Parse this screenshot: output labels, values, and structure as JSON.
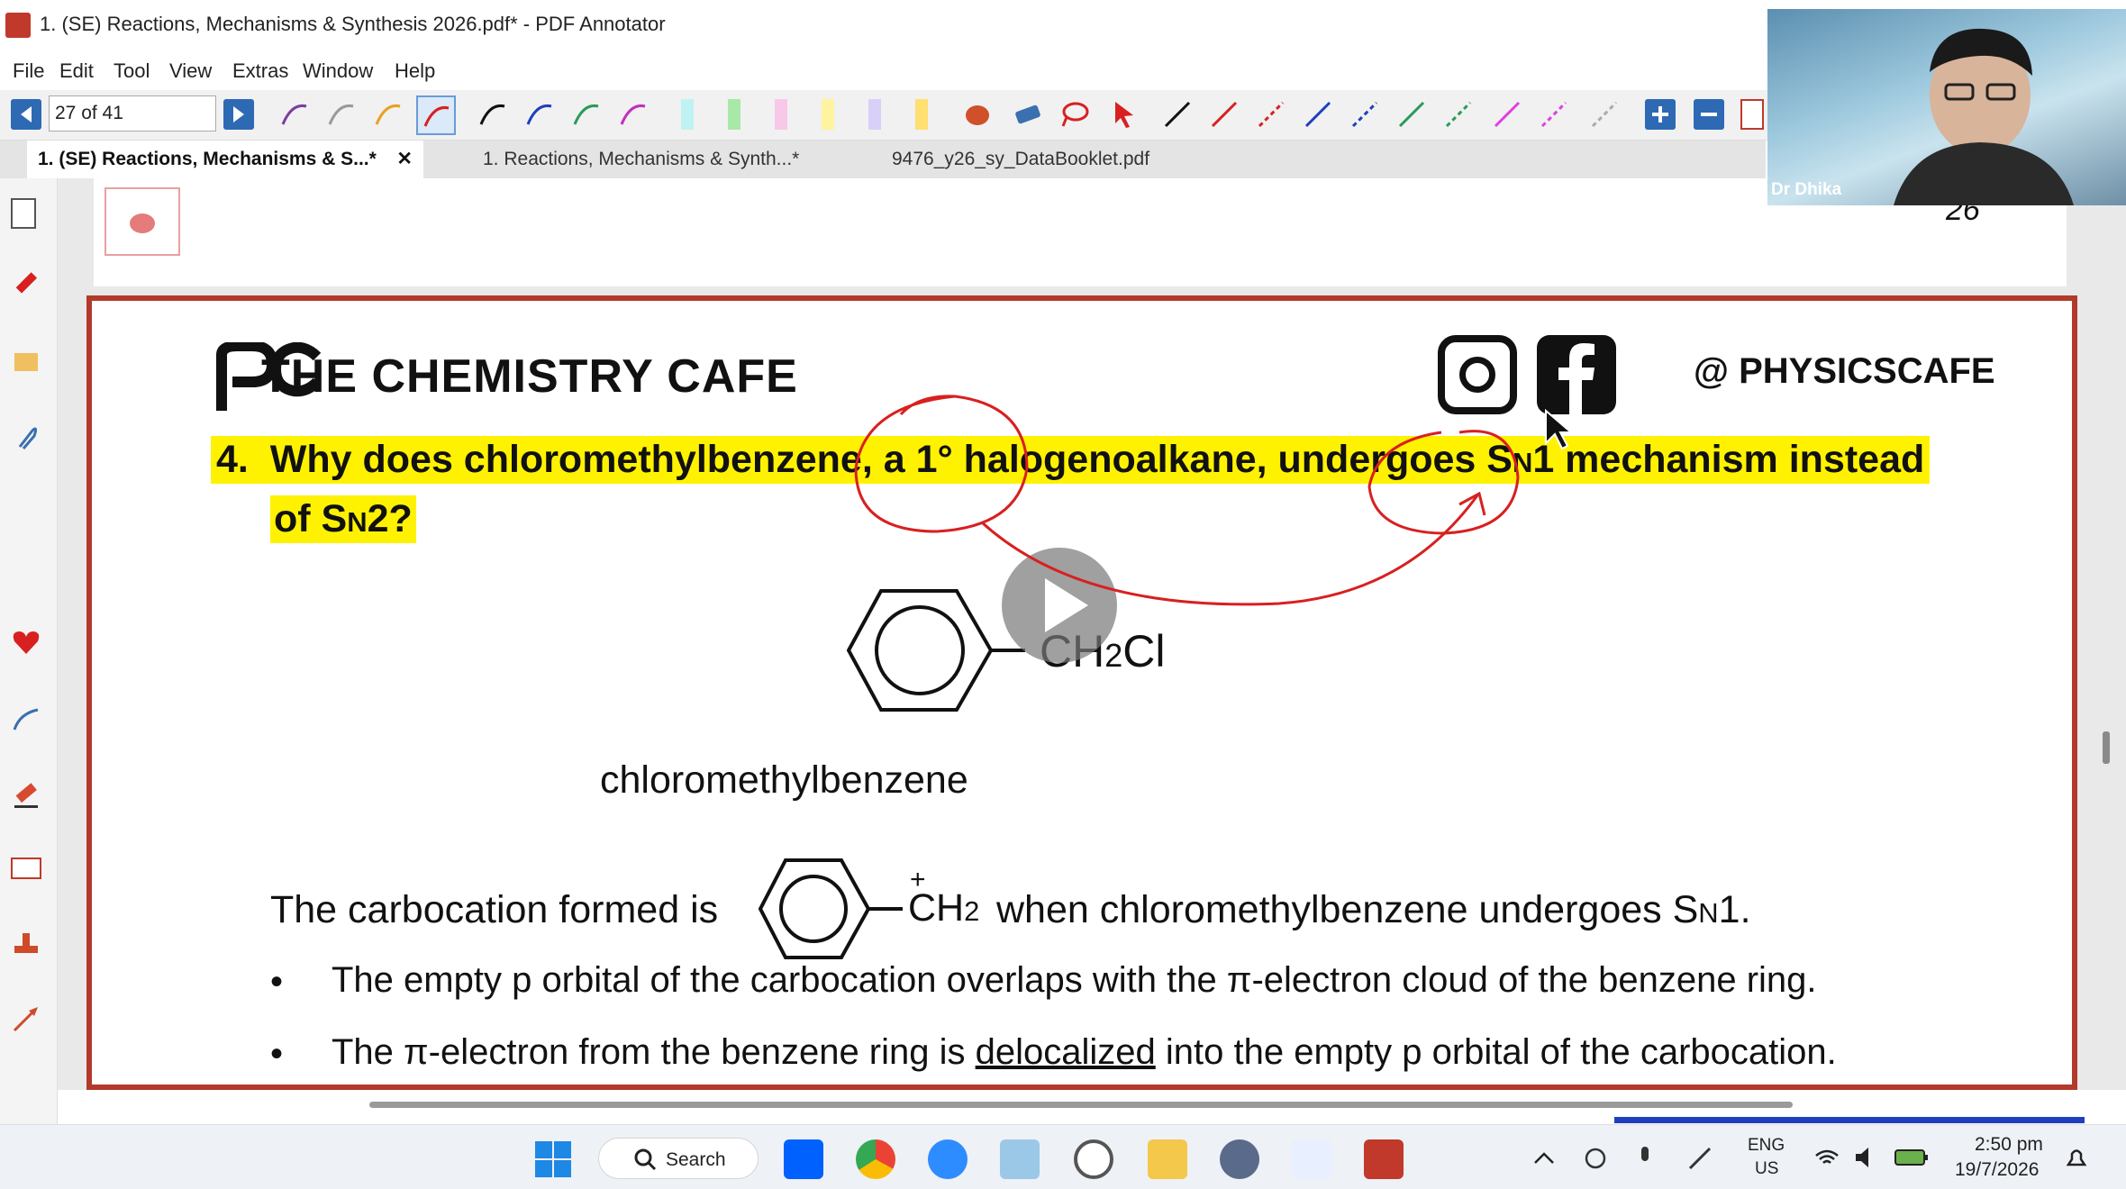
{
  "window": {
    "title": "1. (SE) Reactions, Mechanisms & Synthesis 2026.pdf* - PDF Annotator"
  },
  "menu": [
    "File",
    "Edit",
    "Tool",
    "View",
    "Extras",
    "Window",
    "Help"
  ],
  "toolbar": {
    "page_indicator": "27 of 41"
  },
  "tabs": [
    {
      "label": "1. (SE) Reactions, Mechanisms & S...*",
      "active": true,
      "close": "✕"
    },
    {
      "label": "1. Reactions, Mechanisms & Synth...*",
      "active": false
    },
    {
      "label": "9476_y26_sy_DataBooklet.pdf",
      "active": false
    }
  ],
  "previous_page": {
    "page_number": "26"
  },
  "webcam": {
    "name": "Dr Dhika"
  },
  "page": {
    "brand": "THE CHEMISTRY CAFE",
    "handle": "@ PHYSICSCAFE",
    "question_number": "4.",
    "question_line1": "Why does chloromethylbenzene, a 1° halogenoalkane, undergoes S",
    "question_line1_sub": "N",
    "question_line1_end": "1 mechanism instead",
    "question_line2": "of S",
    "question_line2_sub": "N",
    "question_line2_end": "2?",
    "structure_group_a": "CH",
    "structure_group_sub": "2",
    "structure_group_b": "Cl",
    "structure_name": "chloromethylbenzene",
    "carbocation_prefix": "The carbocation formed is",
    "carbocation_plus": "+",
    "carbocation_group": "CH",
    "carbocation_group_sub": "2",
    "carbocation_suffix": "when chloromethylbenzene undergoes S",
    "carbocation_suffix_sub": "N",
    "carbocation_suffix_end": "1.",
    "bullets": [
      "The empty p orbital of the carbocation overlaps with the π-electron cloud of the benzene ring.",
      "The π-electron from the benzene ring is"
    ],
    "bullet2_underlined": "delocalized",
    "bullet2_end": "into the empty p orbital of the carbocation."
  },
  "taskbar": {
    "search_label": "Search",
    "lang_top": "ENG",
    "lang_bottom": "US",
    "time": "2:50 pm",
    "date": "19/7/2026"
  },
  "colors": {
    "highlight": "#fff200",
    "annotation_red": "#d82020",
    "page_border": "#b23a2a",
    "nav_blue": "#2e6ab4"
  }
}
